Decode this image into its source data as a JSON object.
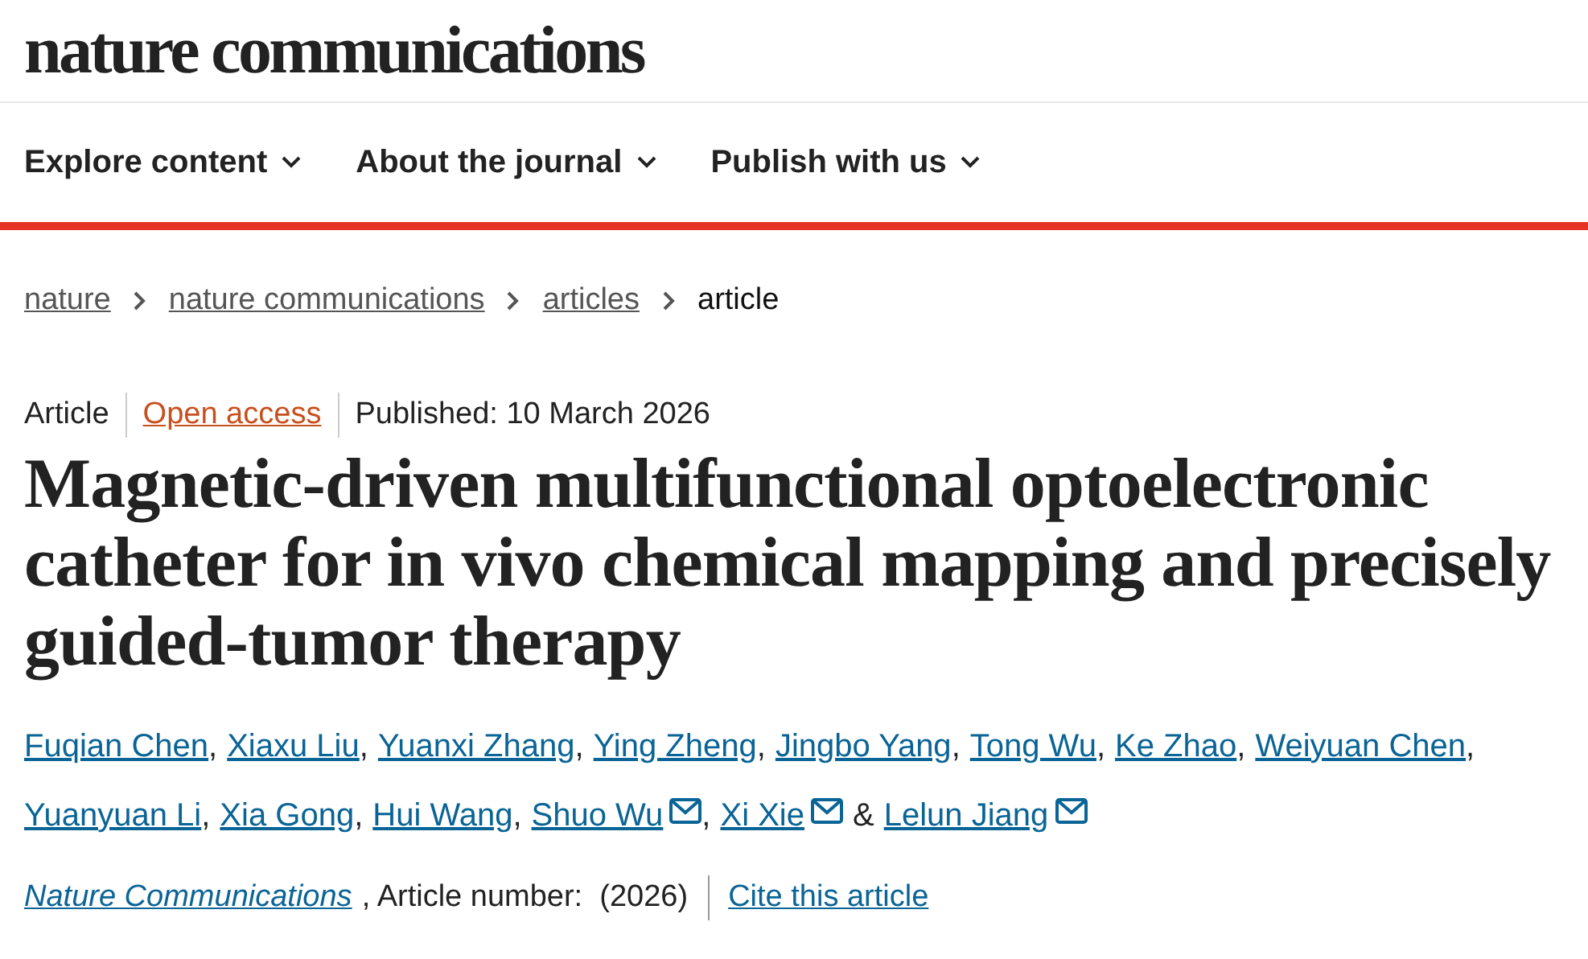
{
  "logo": "nature communications",
  "nav": [
    {
      "label": "Explore content"
    },
    {
      "label": "About the journal"
    },
    {
      "label": "Publish with us"
    }
  ],
  "breadcrumbs": [
    {
      "label": "nature",
      "current": false
    },
    {
      "label": "nature communications",
      "current": false
    },
    {
      "label": "articles",
      "current": false
    },
    {
      "label": "article",
      "current": true
    }
  ],
  "meta": {
    "type": "Article",
    "access": "Open access",
    "published": "Published: 10 March 2026"
  },
  "title": "Magnetic-driven multifunctional optoelectronic catheter for in vivo chemical mapping and precisely guided-tumor therapy",
  "authors": [
    {
      "name": "Fuqian Chen",
      "email": false,
      "after": ","
    },
    {
      "name": "Xiaxu Liu",
      "email": false,
      "after": ","
    },
    {
      "name": "Yuanxi Zhang",
      "email": false,
      "after": ","
    },
    {
      "name": "Ying Zheng",
      "email": false,
      "after": ","
    },
    {
      "name": "Jingbo Yang",
      "email": false,
      "after": ","
    },
    {
      "name": "Tong Wu",
      "email": false,
      "after": ","
    },
    {
      "name": "Ke Zhao",
      "email": false,
      "after": ","
    },
    {
      "name": "Weiyuan Chen",
      "email": false,
      "after": ","
    },
    {
      "name": "Yuanyuan Li",
      "email": false,
      "after": ","
    },
    {
      "name": "Xia Gong",
      "email": false,
      "after": ","
    },
    {
      "name": "Hui Wang",
      "email": false,
      "after": ","
    },
    {
      "name": "Shuo Wu",
      "email": true,
      "after": ","
    },
    {
      "name": "Xi Xie",
      "email": true,
      "after": "&"
    },
    {
      "name": "Lelun Jiang",
      "email": true
    }
  ],
  "citation": {
    "journal": "Nature Communications",
    "number": ", Article number:  (2026)",
    "cite": "Cite this article"
  }
}
